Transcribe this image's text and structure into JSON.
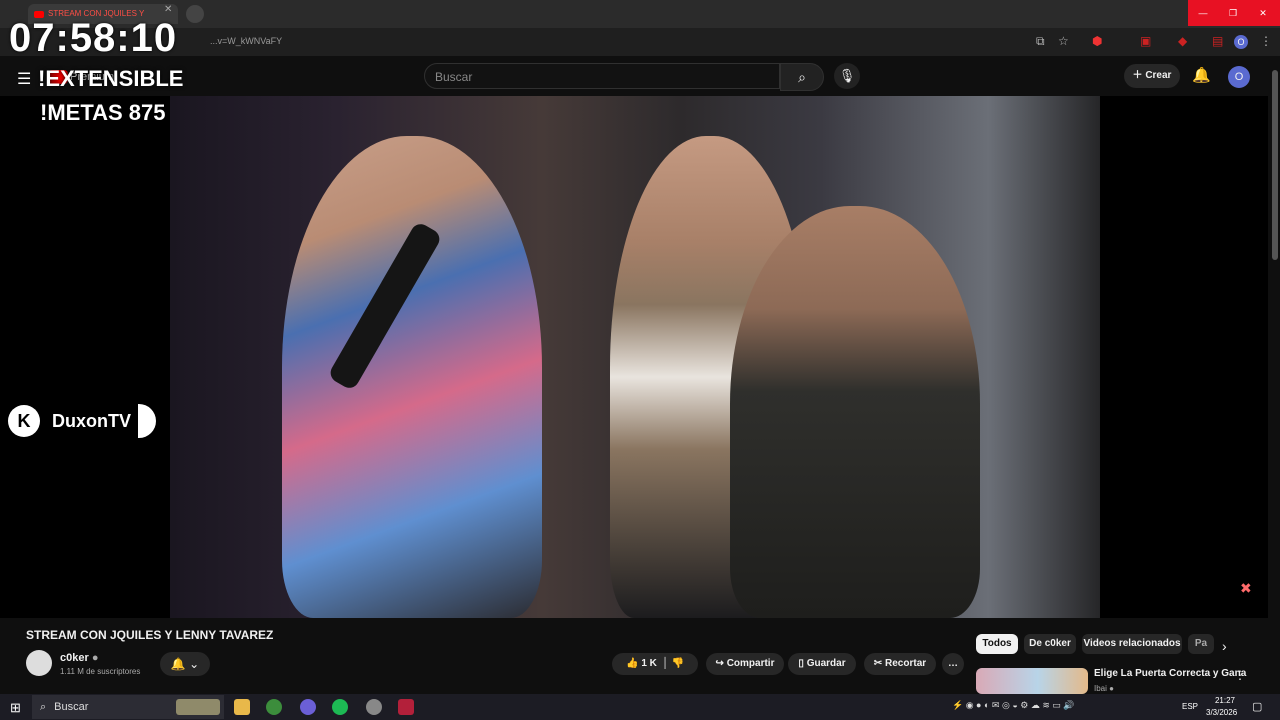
{
  "browser": {
    "tab_title": "STREAM CON JQUILES Y",
    "tab_close": "✕",
    "url": "...v=W_kWNVaFY",
    "window_controls": [
      "—",
      "❐",
      "✕"
    ],
    "profile_letter": "O"
  },
  "overlay": {
    "clock": "07:58:10",
    "line1": "!EXTENSIBLE",
    "line2": "!METAS 875",
    "badge_letter": "K",
    "badge_name": "DuxonTV"
  },
  "youtube": {
    "menu_icon": "☰",
    "premium_label": "Premium",
    "search_placeholder": "Buscar",
    "create_label": "Crear",
    "avatar_letter": "O",
    "video": {
      "title": "STREAM CON JQUILES Y LENNY TAVAREZ",
      "channel": "c0ker",
      "subscribers": "1.11 M de suscriptores",
      "likes": "1 K",
      "share_label": "Compartir",
      "save_label": "Guardar",
      "clip_label": "Recortar"
    },
    "chips": [
      "Todos",
      "De c0ker",
      "Videos relacionados",
      "Pa"
    ],
    "recommendation": {
      "title": "Elige La Puerta Correcta y Gana",
      "channel": "Ibai"
    }
  },
  "taskbar": {
    "search_label": "Buscar",
    "language": "ESP",
    "time": "21:27",
    "date": "3/3/2026"
  }
}
